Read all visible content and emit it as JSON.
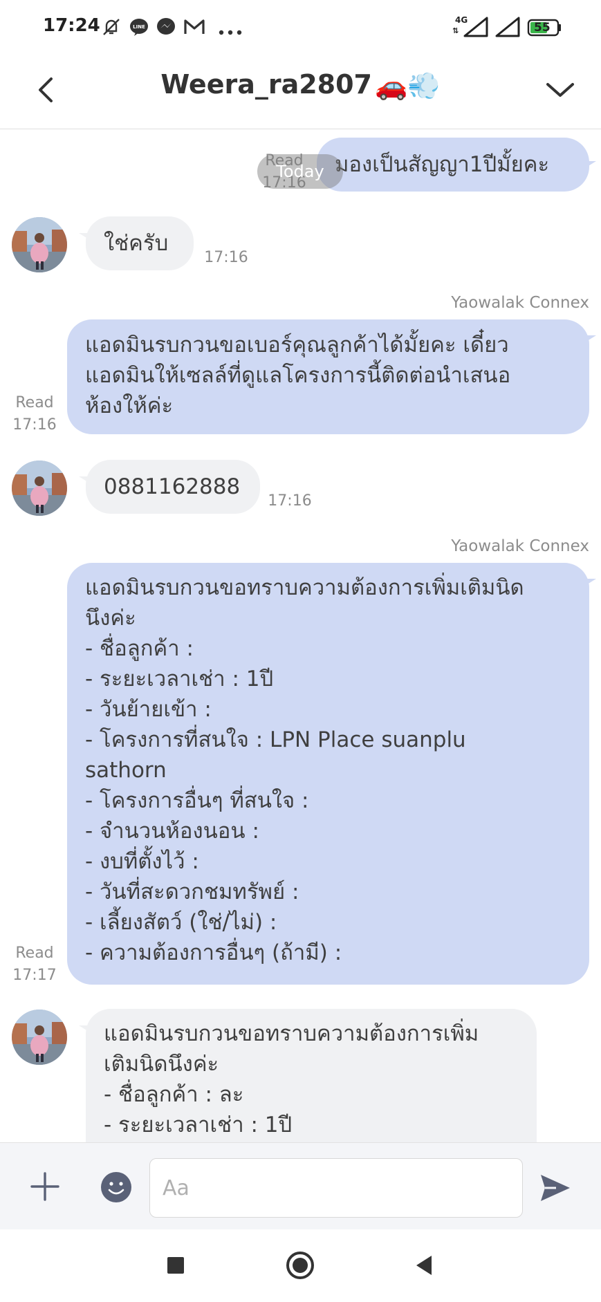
{
  "status_bar": {
    "time": "17:24",
    "network_label": "4G",
    "battery": "55",
    "icons": [
      "mute-bell-icon",
      "line-app-icon",
      "messenger-icon",
      "gmail-icon",
      "more-dots-icon",
      "signal-icon",
      "signal-icon",
      "battery-icon"
    ]
  },
  "header": {
    "title": "Weera_ra2807",
    "title_emoji": "🚗💨",
    "back_icon": "chevron-left-icon",
    "menu_icon": "chevron-down-icon"
  },
  "chat": {
    "date_divider": "Today",
    "messages": [
      {
        "from": "me",
        "lines": [
          "มองเป็นสัญญา1ปีมั้ยคะ"
        ],
        "read": "Read",
        "time": "17:16"
      },
      {
        "from": "them",
        "lines": [
          "ใช่ครับ"
        ],
        "time": "17:16"
      },
      {
        "from": "me",
        "sender": "Yaowalak Connex",
        "lines": [
          "แอดมินรบกวนขอเบอร์คุณลูกค้าได้มั้ยคะ เดี๋ยว",
          "แอดมินให้เซลล์ที่ดูแลโครงการนี้ติดต่อนำเสนอ",
          "ห้องให้ค่ะ"
        ],
        "read": "Read",
        "time": "17:16"
      },
      {
        "from": "them",
        "lines": [
          "0881162888"
        ],
        "time": "17:16"
      },
      {
        "from": "me",
        "sender": "Yaowalak Connex",
        "lines": [
          "แอดมินรบกวนขอทราบความต้องการเพิ่มเติมนิด",
          "นึงค่ะ",
          "- ชื่อลูกค้า :",
          "- ระยะเวลาเช่า :  1ปี",
          "- วันย้ายเข้า :",
          "- โครงการที่สนใจ : LPN Place suanplu",
          "sathorn",
          "- โครงการอื่นๆ ที่สนใจ :",
          "- จำนวนห้องนอน :",
          "- งบที่ตั้งไว้ :",
          "- วันที่สะดวกชมทรัพย์ :",
          "- เลี้ยงสัตว์ (ใช่/ไม่) :",
          "- ความต้องการอื่นๆ (ถ้ามี) :"
        ],
        "read": "Read",
        "time": "17:17"
      },
      {
        "from": "them",
        "lines": [
          "แอดมินรบกวนขอทราบความต้องการเพิ่ม",
          "เติมนิดนึงค่ะ",
          "- ชื่อลูกค้า : ละ",
          "- ระยะเวลาเช่า :  1ปี"
        ]
      }
    ]
  },
  "composer": {
    "placeholder": "Aa",
    "plus_icon": "plus-icon",
    "emoji_icon": "emoji-icon",
    "send_icon": "send-icon"
  },
  "nav_bar": {
    "icons": [
      "recents-square-icon",
      "home-circle-icon",
      "back-triangle-icon"
    ]
  },
  "colors": {
    "my_bubble": "#cfd9f4",
    "their_bubble": "#f0f1f3",
    "meta_text": "#8c8c8c",
    "icon_gray": "#5a6177"
  }
}
